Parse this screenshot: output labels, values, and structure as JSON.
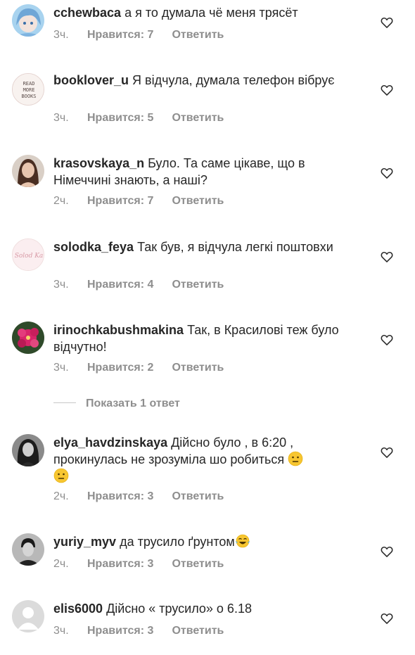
{
  "comments": [
    {
      "username": "cchewbaca",
      "text": "а я то думала чё меня трясёт",
      "time": "3ч.",
      "likes": "Нравится: 7",
      "reply": "Ответить",
      "avatar": "anime-avatar"
    },
    {
      "username": "booklover_u",
      "text": "Я відчула, думала телефон вібрує",
      "time": "3ч.",
      "likes": "Нравится: 5",
      "reply": "Ответить",
      "avatar": "read-more-books-avatar",
      "avatar_text": [
        "READ",
        "MORE",
        "BOOKS"
      ]
    },
    {
      "username": "krasovskaya_n",
      "text": "Було. Та саме цікаве, що в Німеччині знають, а наші?",
      "time": "2ч.",
      "likes": "Нравится: 7",
      "reply": "Ответить",
      "avatar": "photo-avatar"
    },
    {
      "username": "solodka_feya",
      "text": "Так був, я відчула легкі поштовхи",
      "time": "3ч.",
      "likes": "Нравится: 4",
      "reply": "Ответить",
      "avatar": "logo-avatar",
      "avatar_text": [
        "Solod Ka"
      ]
    },
    {
      "username": "irinochkabushmakina",
      "text": "Так, в Красилові теж було відчутно!",
      "time": "3ч.",
      "likes": "Нравится: 2",
      "reply": "Ответить",
      "avatar": "flower-avatar"
    },
    {
      "username": "elya_havdzinskaya",
      "text": "Дійсно було , в 6:20 , прокинулась не зрозуміла шо робиться",
      "time": "2ч.",
      "likes": "Нравится: 3",
      "reply": "Ответить",
      "avatar": "photo-avatar"
    },
    {
      "username": "yuriy_myv",
      "text": "да трусило ґрунтом",
      "time": "2ч.",
      "likes": "Нравится: 3",
      "reply": "Ответить",
      "avatar": "photo-avatar"
    },
    {
      "username": "elis6000",
      "text": "Дійсно « трусило» о 6.18",
      "time": "3ч.",
      "likes": "Нравится: 3",
      "reply": "Ответить",
      "avatar": "default-avatar"
    }
  ],
  "show_replies_label": "Показать 1 ответ",
  "colors": {
    "text": "#262626",
    "meta": "#8e8e8e",
    "divider": "#c7c7c7",
    "background": "#ffffff"
  }
}
